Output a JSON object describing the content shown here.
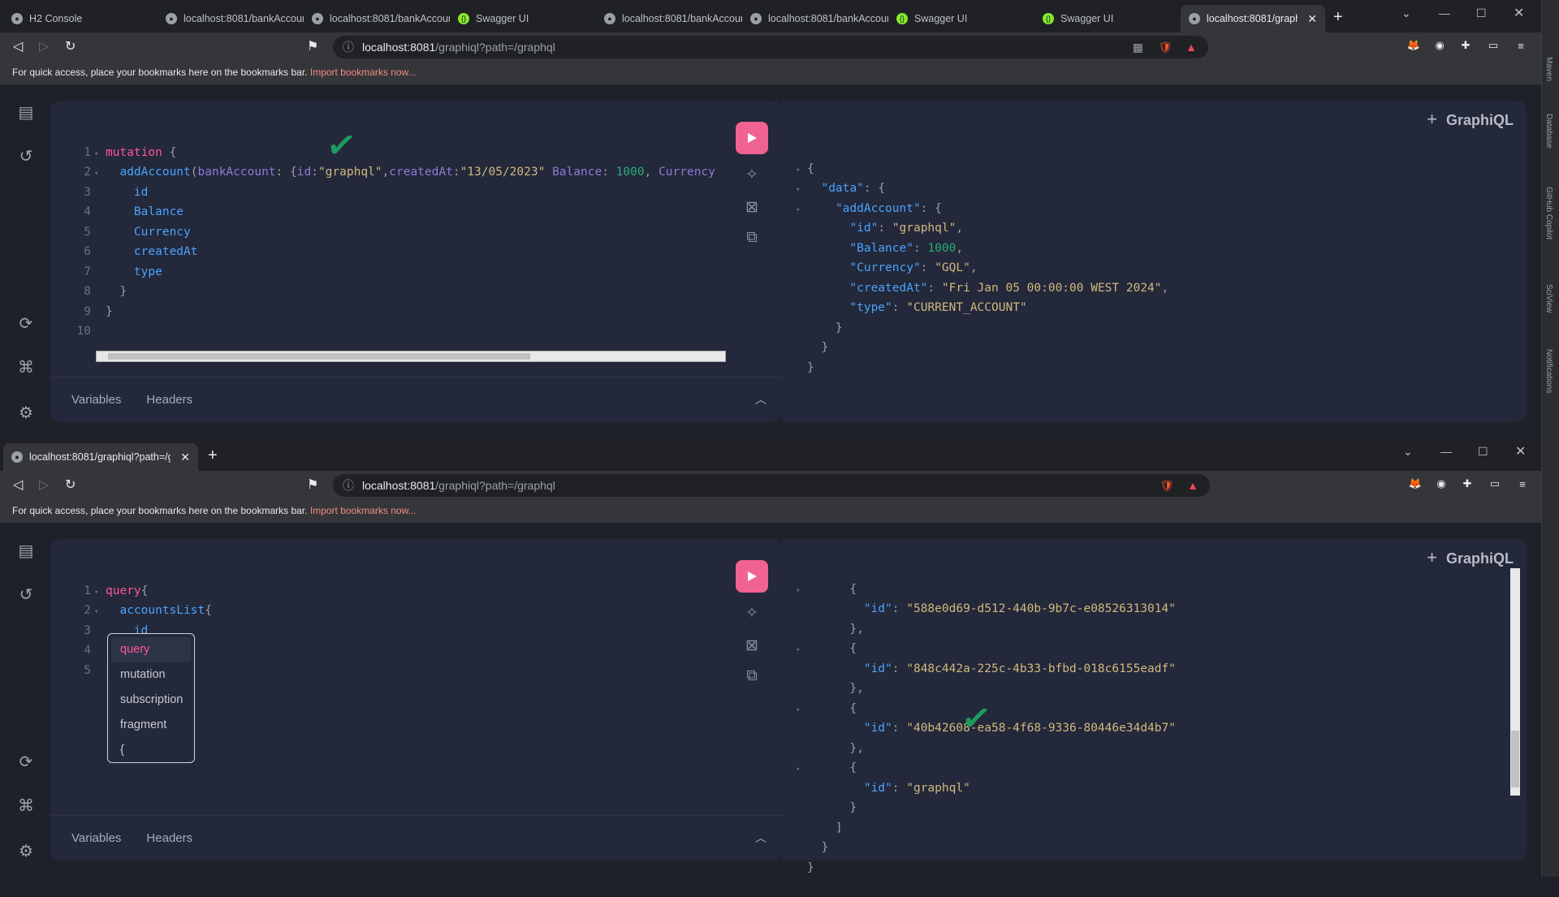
{
  "top": {
    "tabs": [
      {
        "label": "H2 Console",
        "favicon": "globe-icon"
      },
      {
        "label": "localhost:8081/bankAccoun",
        "favicon": "globe-icon"
      },
      {
        "label": "localhost:8081/bankAccoun",
        "favicon": "globe-icon"
      },
      {
        "label": "Swagger UI",
        "favicon": "swagger-icon"
      },
      {
        "label": "localhost:8081/bankAccoun",
        "favicon": "globe-icon"
      },
      {
        "label": "localhost:8081/bankAccoun",
        "favicon": "globe-icon"
      },
      {
        "label": "Swagger UI",
        "favicon": "swagger-icon"
      },
      {
        "label": "Swagger UI",
        "favicon": "swagger-icon"
      },
      {
        "label": "localhost:8081/graphiq",
        "favicon": "globe-icon",
        "active": true
      }
    ],
    "url_host": "localhost:8081",
    "url_path": "/graphiql?path=/graphql",
    "bookmark_text": "For quick access, place your bookmarks here on the bookmarks bar.",
    "bookmark_link": "Import bookmarks now...",
    "graphiql_title": "GraphiQL",
    "variables_label": "Variables",
    "headers_label": "Headers"
  },
  "bottom": {
    "tab_label": "localhost:8081/graphiql?path=/gr",
    "url_host": "localhost:8081",
    "url_path": "/graphiql?path=/graphql",
    "bookmark_text": "For quick access, place your bookmarks here on the bookmarks bar.",
    "bookmark_link": "Import bookmarks now...",
    "graphiql_title": "GraphiQL",
    "variables_label": "Variables",
    "headers_label": "Headers",
    "autocomplete": [
      "query",
      "mutation",
      "subscription",
      "fragment",
      "{"
    ]
  },
  "right_rail": [
    "Maven",
    "Database",
    "GitHub Copilot",
    "SciView",
    "Notifications"
  ],
  "colors": {
    "run_button": "#f06292",
    "keyword": "#ff5794",
    "field": "#4aa3ff",
    "string": "#d2b87e",
    "number": "#2bab7c",
    "checkmark": "#1e9c5c"
  }
}
